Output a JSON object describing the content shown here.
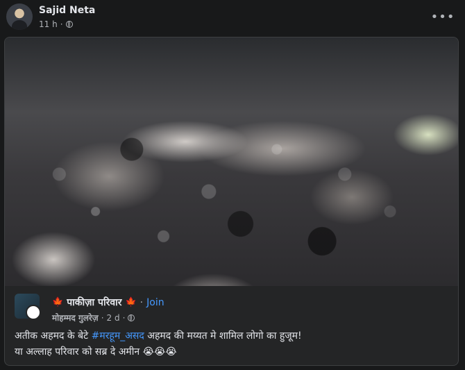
{
  "post": {
    "author": "Sajid Neta",
    "time": "11 h",
    "separator": "·",
    "more_label": "•••"
  },
  "shared": {
    "group_name": "पाकीज़ा परिवार",
    "leaf_left": "🍁",
    "leaf_right": "🍁",
    "dot": "·",
    "join_label": "Join",
    "posted_by": "मोहम्मद गुलरेज़",
    "time": "2 d",
    "separator": "·",
    "caption_line1_prefix": "अतीक अहमद के बेटे ",
    "caption_hashtag": "#मरहूम_असद",
    "caption_line1_suffix": " अहमद की मय्यत मे शामिल लोगो का हुजूम!",
    "caption_line2": "या अल्लाह परिवार को सब्र दे अमीन 😭😭😭"
  }
}
